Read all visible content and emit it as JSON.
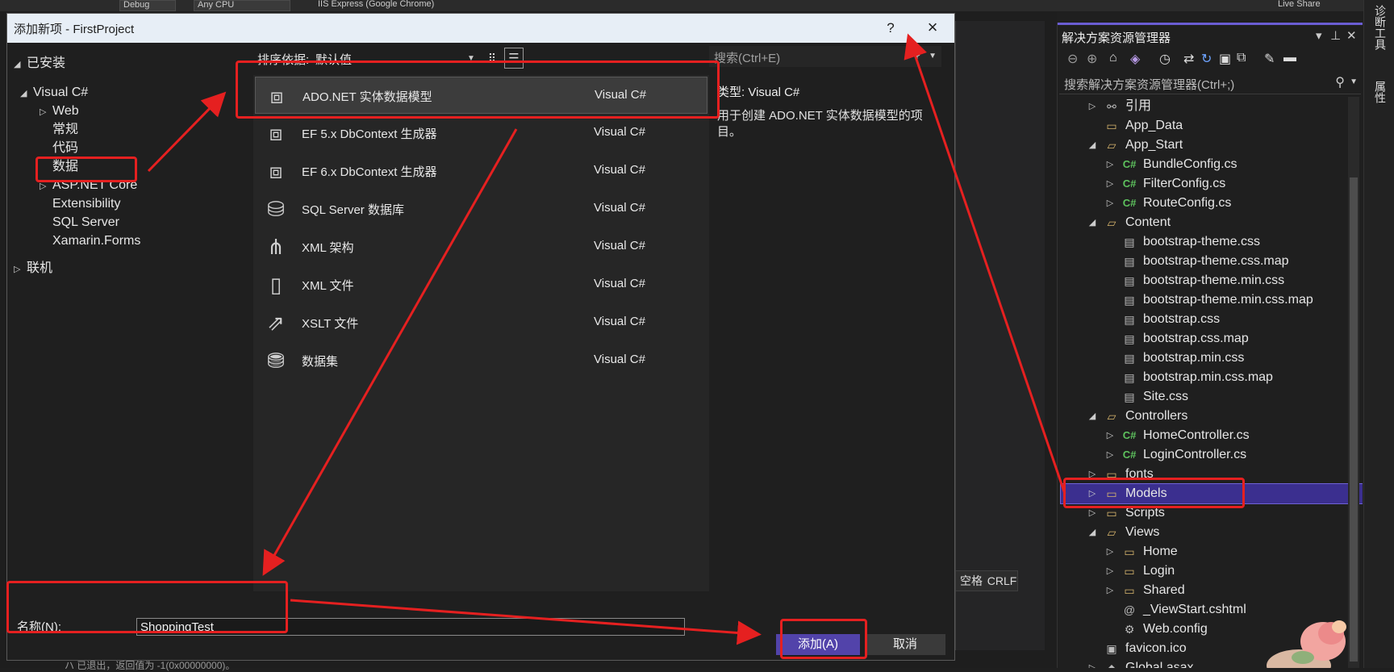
{
  "topstrip": {
    "config": "Debug",
    "platform": "Any CPU",
    "run_target": "IIS Express (Google Chrome)",
    "live_share": "Live Share"
  },
  "dialog": {
    "title": "添加新项 - FirstProject",
    "help": "?",
    "close": "×"
  },
  "categories": {
    "installed": "已安装",
    "visual_csharp": "Visual C#",
    "items": [
      "Web",
      "常规",
      "代码",
      "数据",
      "ASP.NET Core",
      "Extensibility",
      "SQL Server",
      "Xamarin.Forms"
    ],
    "online": "联机"
  },
  "sort": {
    "label": "排序依据:",
    "value": "默认值"
  },
  "templates": [
    {
      "name": "ADO.NET 实体数据模型",
      "lang": "Visual C#",
      "icon": "entity-model-icon"
    },
    {
      "name": "EF 5.x DbContext 生成器",
      "lang": "Visual C#",
      "icon": "entity-model-icon"
    },
    {
      "name": "EF 6.x DbContext 生成器",
      "lang": "Visual C#",
      "icon": "entity-model-icon"
    },
    {
      "name": "SQL Server 数据库",
      "lang": "Visual C#",
      "icon": "database-icon"
    },
    {
      "name": "XML 架构",
      "lang": "Visual C#",
      "icon": "xml-schema-icon"
    },
    {
      "name": "XML 文件",
      "lang": "Visual C#",
      "icon": "xml-file-icon"
    },
    {
      "name": "XSLT 文件",
      "lang": "Visual C#",
      "icon": "xslt-file-icon"
    },
    {
      "name": "数据集",
      "lang": "Visual C#",
      "icon": "dataset-icon"
    }
  ],
  "search": {
    "placeholder": "搜索(Ctrl+E)"
  },
  "info": {
    "type": "类型: Visual C#",
    "description": "用于创建 ADO.NET 实体数据模型的项目。"
  },
  "name_field": {
    "label": "名称(N):",
    "value": "ShoppingTest"
  },
  "buttons": {
    "add": "添加(A)",
    "cancel": "取消"
  },
  "background_status": {
    "space": "空格",
    "crlf": "CRLF"
  },
  "output_line": "ハ 已退出，返回值为 -1(0x00000000)。",
  "solution_explorer": {
    "title": "解决方案资源管理器",
    "search_placeholder": "搜索解决方案资源管理器(Ctrl+;)",
    "tree": [
      {
        "label": "引用",
        "icon": "references-icon",
        "arrow": "▷",
        "indent": 0
      },
      {
        "label": "App_Data",
        "icon": "folder-icon",
        "arrow": "",
        "indent": 0
      },
      {
        "label": "App_Start",
        "icon": "folder-open-icon",
        "arrow": "◢",
        "indent": 0
      },
      {
        "label": "BundleConfig.cs",
        "icon": "csharp-file-icon",
        "arrow": "▷",
        "indent": 1
      },
      {
        "label": "FilterConfig.cs",
        "icon": "csharp-file-icon",
        "arrow": "▷",
        "indent": 1
      },
      {
        "label": "RouteConfig.cs",
        "icon": "csharp-file-icon",
        "arrow": "▷",
        "indent": 1
      },
      {
        "label": "Content",
        "icon": "folder-open-icon",
        "arrow": "◢",
        "indent": 0
      },
      {
        "label": "bootstrap-theme.css",
        "icon": "css-file-icon",
        "arrow": "",
        "indent": 1
      },
      {
        "label": "bootstrap-theme.css.map",
        "icon": "text-file-icon",
        "arrow": "",
        "indent": 1
      },
      {
        "label": "bootstrap-theme.min.css",
        "icon": "css-file-icon",
        "arrow": "",
        "indent": 1
      },
      {
        "label": "bootstrap-theme.min.css.map",
        "icon": "text-file-icon",
        "arrow": "",
        "indent": 1
      },
      {
        "label": "bootstrap.css",
        "icon": "css-file-icon",
        "arrow": "",
        "indent": 1
      },
      {
        "label": "bootstrap.css.map",
        "icon": "text-file-icon",
        "arrow": "",
        "indent": 1
      },
      {
        "label": "bootstrap.min.css",
        "icon": "css-file-icon",
        "arrow": "",
        "indent": 1
      },
      {
        "label": "bootstrap.min.css.map",
        "icon": "text-file-icon",
        "arrow": "",
        "indent": 1
      },
      {
        "label": "Site.css",
        "icon": "css-file-icon",
        "arrow": "",
        "indent": 1
      },
      {
        "label": "Controllers",
        "icon": "folder-open-icon",
        "arrow": "◢",
        "indent": 0
      },
      {
        "label": "HomeController.cs",
        "icon": "csharp-file-icon",
        "arrow": "▷",
        "indent": 1
      },
      {
        "label": "LoginController.cs",
        "icon": "csharp-file-icon",
        "arrow": "▷",
        "indent": 1
      },
      {
        "label": "fonts",
        "icon": "folder-icon",
        "arrow": "▷",
        "indent": 0
      },
      {
        "label": "Models",
        "icon": "folder-icon",
        "arrow": "▷",
        "indent": 0,
        "selected": true
      },
      {
        "label": "Scripts",
        "icon": "folder-icon",
        "arrow": "▷",
        "indent": 0
      },
      {
        "label": "Views",
        "icon": "folder-open-icon",
        "arrow": "◢",
        "indent": 0
      },
      {
        "label": "Home",
        "icon": "folder-icon",
        "arrow": "▷",
        "indent": 1
      },
      {
        "label": "Login",
        "icon": "folder-icon",
        "arrow": "▷",
        "indent": 1
      },
      {
        "label": "Shared",
        "icon": "folder-icon",
        "arrow": "▷",
        "indent": 1
      },
      {
        "label": "_ViewStart.cshtml",
        "icon": "razor-file-icon",
        "arrow": "",
        "indent": 1
      },
      {
        "label": "Web.config",
        "icon": "config-file-icon",
        "arrow": "",
        "indent": 1
      },
      {
        "label": "favicon.ico",
        "icon": "ico-file-icon",
        "arrow": "",
        "indent": 0
      },
      {
        "label": "Global.asax",
        "icon": "asax-file-icon",
        "arrow": "▷",
        "indent": 0
      }
    ]
  },
  "side_tabs": [
    "诊断工具",
    "属性"
  ],
  "colors": {
    "accent": "#5243aa",
    "annotation": "#e52020",
    "selection": "#3b2f8f",
    "title_bar": "#e7eef6"
  }
}
